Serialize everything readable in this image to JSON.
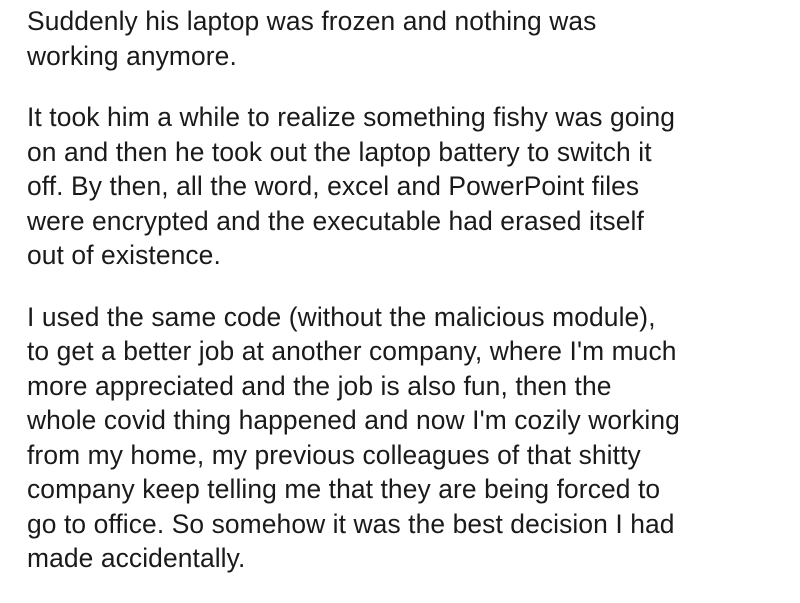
{
  "paragraphs": [
    {
      "lines": [
        "Suddenly his laptop was frozen and nothing was",
        "working anymore."
      ]
    },
    {
      "lines": [
        "It took him a while to realize something fishy was going",
        "on and then he took out the laptop battery to switch it",
        "off. By then, all the word, excel and PowerPoint files",
        "were encrypted and the executable had erased itself",
        "out of existence."
      ]
    },
    {
      "lines": [
        "I used the same code (without the malicious module),",
        "to get a better job at another company, where I'm much",
        "more appreciated and the job is also fun, then the",
        "whole covid thing happened and now I'm cozily working",
        "from my home, my previous colleagues of that shitty",
        "company keep telling me that they are being forced to",
        "go to office. So somehow it was the best decision I had",
        "made accidentally."
      ]
    }
  ]
}
